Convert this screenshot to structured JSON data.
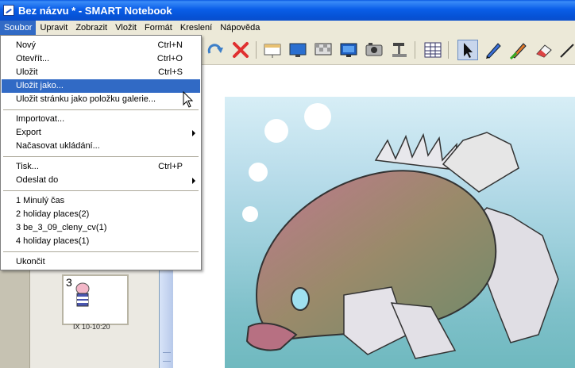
{
  "window": {
    "title": "Bez názvu * - SMART Notebook"
  },
  "menubar": {
    "items": [
      "Soubor",
      "Upravit",
      "Zobrazit",
      "Vložit",
      "Formát",
      "Kreslení",
      "Nápověda"
    ]
  },
  "file_menu": {
    "items": [
      {
        "label": "Nový",
        "shortcut": "Ctrl+N"
      },
      {
        "label": "Otevřít...",
        "shortcut": "Ctrl+O"
      },
      {
        "label": "Uložit",
        "shortcut": "Ctrl+S"
      },
      {
        "label": "Uložit jako...",
        "shortcut": ""
      },
      {
        "label": "Uložit stránku jako položku galerie...",
        "shortcut": ""
      },
      {
        "label": "Importovat...",
        "shortcut": ""
      },
      {
        "label": "Export",
        "shortcut": ""
      },
      {
        "label": "Načasovat ukládání...",
        "shortcut": ""
      },
      {
        "label": "Tisk...",
        "shortcut": "Ctrl+P"
      },
      {
        "label": "Odeslat do",
        "shortcut": ""
      },
      {
        "label": "1 Minulý čas",
        "shortcut": ""
      },
      {
        "label": "2 holiday places(2)",
        "shortcut": ""
      },
      {
        "label": "3 be_3_09_cleny_cv(1)",
        "shortcut": ""
      },
      {
        "label": "4 holiday places(1)",
        "shortcut": ""
      },
      {
        "label": "Ukončit",
        "shortcut": ""
      }
    ]
  },
  "page_sorter": {
    "thumbnail_number": "3",
    "thumbnail_label": "IX 10-10:20"
  },
  "toolbar": {
    "icons": [
      "redo-icon",
      "delete-icon",
      "screen-shade-icon",
      "full-screen-icon",
      "transparent-bg-icon",
      "dual-display-icon",
      "screen-capture-icon",
      "document-camera-icon",
      "table-icon",
      "select-icon",
      "pen-icon",
      "creative-pen-icon",
      "eraser-icon",
      "line-icon"
    ]
  },
  "colors": {
    "accent": "#316ac5",
    "titlebar": "#0a5ee8"
  }
}
